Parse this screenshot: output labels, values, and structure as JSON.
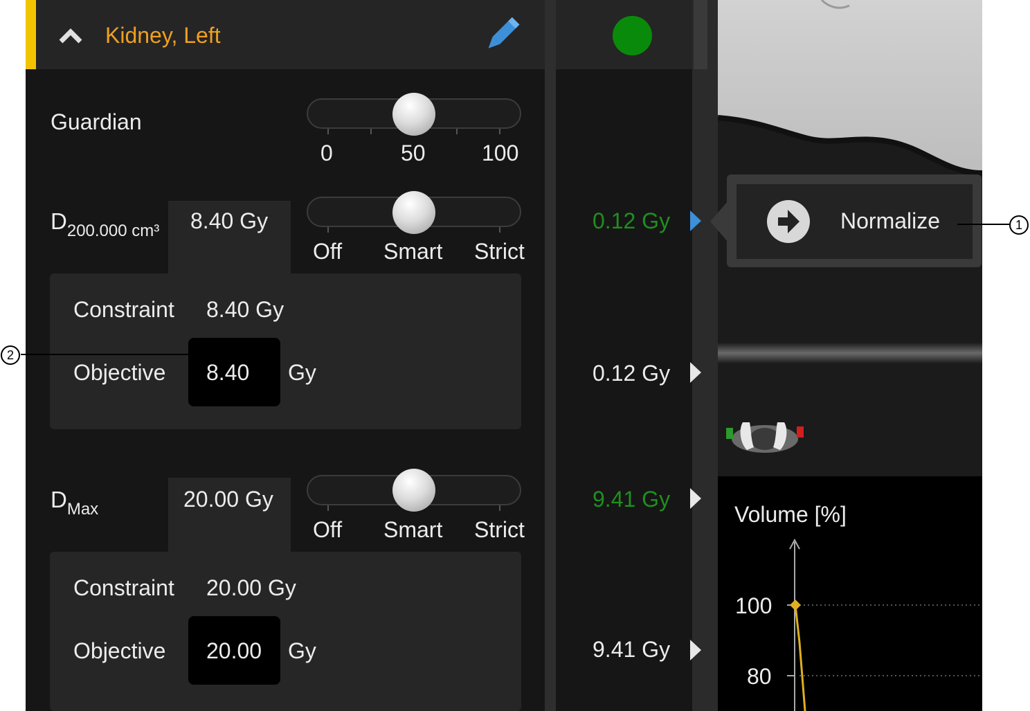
{
  "structure": {
    "name": "Kidney, Left",
    "status_color": "#0a8a0a",
    "accent_color": "#f2c400"
  },
  "guardian": {
    "label": "Guardian",
    "value": 50,
    "scale": [
      "0",
      "50",
      "100"
    ]
  },
  "constraints": [
    {
      "metric": "D",
      "metric_sub": "200.000 cm³",
      "tab_value": "8.40 Gy",
      "mode_options": [
        "Off",
        "Smart",
        "Strict"
      ],
      "mode": "Smart",
      "constraint_label": "Constraint",
      "constraint_value": "8.40 Gy",
      "objective_label": "Objective",
      "objective_value": "8.40",
      "objective_unit": "Gy",
      "result_1": "0.12 Gy",
      "result_2": "0.12 Gy"
    },
    {
      "metric": "D",
      "metric_sub": "Max",
      "tab_value": "20.00 Gy",
      "mode_options": [
        "Off",
        "Smart",
        "Strict"
      ],
      "mode": "Smart",
      "constraint_label": "Constraint",
      "constraint_value": "20.00 Gy",
      "objective_label": "Objective",
      "objective_value": "20.00",
      "objective_unit": "Gy",
      "result_1": "9.41 Gy",
      "result_2": "9.41 Gy"
    }
  ],
  "normalize": {
    "label": "Normalize",
    "icon": "arrow-right-circle-icon"
  },
  "dvh": {
    "ylabel": "Volume [%]",
    "ticks": [
      "100",
      "80"
    ],
    "curve_color": "#e0b020"
  },
  "callouts": [
    "1",
    "2"
  ],
  "icons": {
    "collapse": "chevron-up-icon",
    "edit": "pencil-icon",
    "orientation": "orientation-figure-icon"
  }
}
